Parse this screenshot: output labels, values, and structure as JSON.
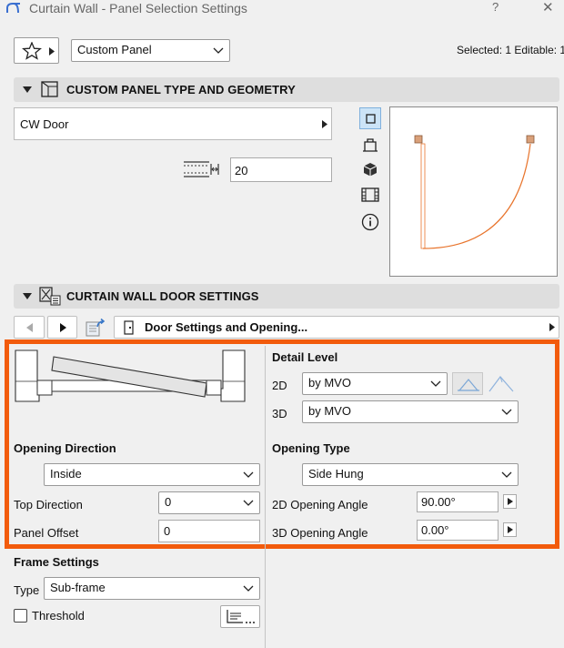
{
  "window": {
    "title": "Curtain Wall - Panel Selection Settings",
    "help_label": "?",
    "close_label": "✕"
  },
  "toolbar": {
    "favorites_icon": "star-icon",
    "panel_select": "Custom Panel",
    "selection_info": "Selected: 1 Editable: 1"
  },
  "sections": {
    "panel_type": "CUSTOM PANEL TYPE AND GEOMETRY",
    "door_settings": "CURTAIN WALL DOOR SETTINGS"
  },
  "panel": {
    "object_name": "CW Door",
    "thickness_value": "20"
  },
  "door_tab": {
    "page_title": "Door Settings and Opening..."
  },
  "door": {
    "opening_direction_label": "Opening Direction",
    "opening_direction_value": "Inside",
    "top_direction_label": "Top Direction",
    "top_direction_value": "0",
    "panel_offset_label": "Panel Offset",
    "panel_offset_value": "0",
    "detail_level_label": "Detail Level",
    "detail_2d_label": "2D",
    "detail_2d_value": "by MVO",
    "detail_3d_label": "3D",
    "detail_3d_value": "by MVO",
    "opening_type_label": "Opening Type",
    "opening_type_value": "Side Hung",
    "angle_2d_label": "2D Opening Angle",
    "angle_2d_value": "90.00°",
    "angle_3d_label": "3D Opening Angle",
    "angle_3d_value": "0.00°"
  },
  "frame": {
    "heading": "Frame Settings",
    "type_label": "Type",
    "type_value": "Sub-frame",
    "threshold_label": "Threshold",
    "threshold_checked": false
  },
  "colors": {
    "highlight": "#f25b0c",
    "door_swing": "#e8742c",
    "section_bg": "#dedede"
  }
}
